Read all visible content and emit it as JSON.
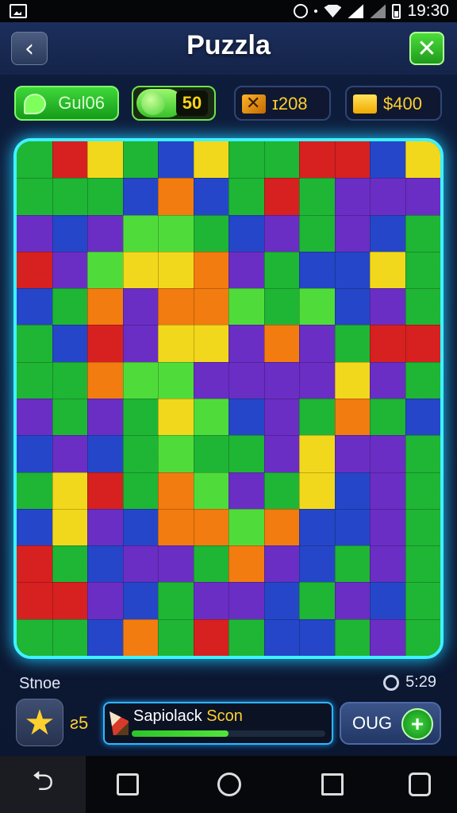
{
  "status_bar": {
    "time": "19:30"
  },
  "header": {
    "title": "Puzzla",
    "back_glyph": "‹",
    "close_glyph": "✕"
  },
  "resources": {
    "guide_label": "Gul06",
    "toggle_value": "50",
    "coins": "ɪ208",
    "cash": "$400"
  },
  "board": {
    "columns": 12,
    "rows": 14,
    "palette": {
      "G": "#1fb535",
      "L": "#4fdc3a",
      "P": "#6a2ec4",
      "B": "#2546c8",
      "Y": "#f2d81c",
      "O": "#f27c10",
      "R": "#d72020"
    },
    "layout": [
      "GRYGBYGGRRBY",
      "GGGBOBGRGPPP",
      "PBPLLGBPGPBG",
      "RPLYYOPGBBYG",
      "BGOPOOLGLBPG",
      "GBRPYYPOPGRR",
      "GGOLLPPPPYPG",
      "PGPGYLBPGOGB",
      "BPBGLGGPYPPG",
      "GYRGOLPGYBPG",
      "BYPBOOLOBBPG",
      "RGBPPGOPBGPG",
      "RRPBGPPBGPBG",
      "GGBOGRGBBGPG"
    ]
  },
  "footer": {
    "score_label": "Stnoe",
    "timer": "5:29",
    "stars": "ƨ5",
    "progress_label_a": "Sapiolack ",
    "progress_label_b": "Scon",
    "progress_fraction": 0.5,
    "action_label": "OUG"
  },
  "nav": {
    "back_glyph": "⮌"
  }
}
